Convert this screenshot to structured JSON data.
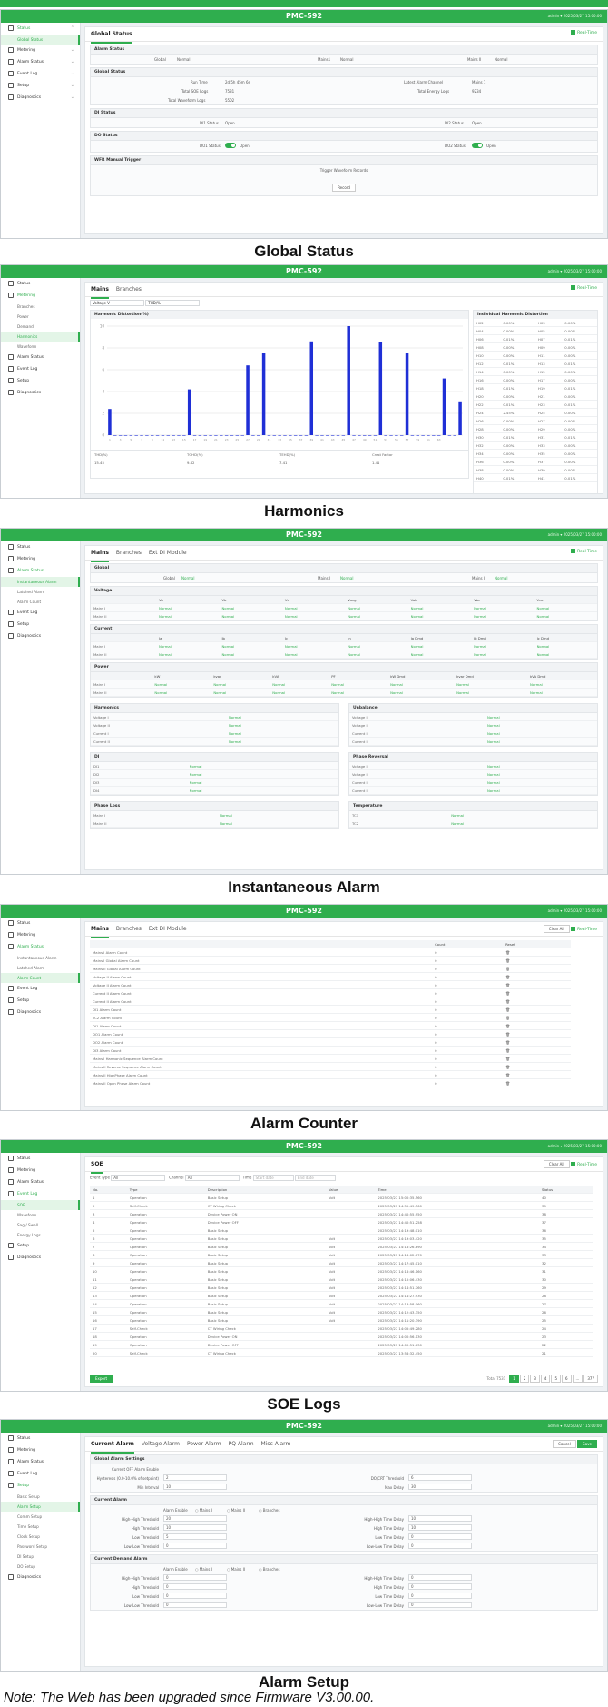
{
  "app_title": "PMC-592",
  "header_right": "admin ▾   2025/03/27  15:00:00",
  "colors": {
    "brand": "#2fae4e",
    "bar": "#1f2fd6"
  },
  "global": {
    "caption": "Global Status",
    "tab": "Global Status",
    "realtime": "Real-Time",
    "sidebar": [
      "Status",
      "Global Status",
      "Metering",
      "Alarm Status",
      "Event Log",
      "Setup",
      "Diagnostics"
    ],
    "alarm_status": {
      "title": "Alarm Status",
      "global_label": "Global",
      "global_val": "Normal",
      "mains_label": "Mains1",
      "mains_val": "Normal",
      "mains2_label": "Mains II",
      "mains2_val": "Normal"
    },
    "global_status": {
      "title": "Global Status",
      "rows": [
        [
          "Run Time",
          "2d 5h 45m 6s",
          "Latest Alarm Channel",
          "Mains 1"
        ],
        [
          "Total SOE Logs",
          "7531",
          "Total Energy Logs",
          "9234"
        ],
        [
          "Total Waveform Logs",
          "5502",
          "",
          ""
        ]
      ]
    },
    "di": {
      "title": "DI Status",
      "a": "DI1 Status",
      "av": "Open",
      "b": "DI2 Status",
      "bv": "Open"
    },
    "do": {
      "title": "DO Status",
      "a": "DO1 Status",
      "av": "Open",
      "b": "DO2 Status",
      "bv": "Open"
    },
    "wfr": {
      "title": "WFR Manual Trigger",
      "label": "Trigger Waveform Records",
      "button": "Record"
    }
  },
  "harm": {
    "caption": "Harmonics",
    "tabs": [
      "Mains",
      "Branches"
    ],
    "sel1": "Voltage V",
    "sel2": "THD/%",
    "panel_title": "Harmonic Distortion(%)",
    "right_title": "Individual Harmonic Distortion",
    "foot": [
      "THD(%)",
      "TOHD(%)",
      "TEHD(%)",
      "Crest Factor"
    ],
    "footv": [
      "15.45",
      "9.82",
      "7.41",
      "1.41"
    ],
    "sidebar": [
      "Status",
      "Metering",
      "Branches",
      "Power",
      "Demand",
      "Harmonics",
      "Waveform",
      "Alarm Status",
      "Event Log",
      "Setup",
      "Diagnostics"
    ],
    "table": [
      [
        "H02",
        "0.00%",
        "H03",
        "0.00%"
      ],
      [
        "H04",
        "0.00%",
        "H05",
        "0.00%"
      ],
      [
        "H06",
        "0.01%",
        "H07",
        "0.01%"
      ],
      [
        "H08",
        "0.00%",
        "H09",
        "0.00%"
      ],
      [
        "H10",
        "0.00%",
        "H11",
        "0.00%"
      ],
      [
        "H12",
        "0.01%",
        "H13",
        "0.01%"
      ],
      [
        "H14",
        "0.00%",
        "H15",
        "0.00%"
      ],
      [
        "H16",
        "0.00%",
        "H17",
        "0.00%"
      ],
      [
        "H18",
        "0.01%",
        "H19",
        "0.01%"
      ],
      [
        "H20",
        "0.00%",
        "H21",
        "0.00%"
      ],
      [
        "H22",
        "0.01%",
        "H23",
        "0.01%"
      ],
      [
        "H24",
        "2.45%",
        "H25",
        "0.00%"
      ],
      [
        "H26",
        "0.00%",
        "H27",
        "0.00%"
      ],
      [
        "H28",
        "0.00%",
        "H29",
        "0.00%"
      ],
      [
        "H30",
        "0.01%",
        "H31",
        "0.01%"
      ],
      [
        "H32",
        "0.00%",
        "H33",
        "0.00%"
      ],
      [
        "H34",
        "0.00%",
        "H35",
        "0.00%"
      ],
      [
        "H36",
        "0.00%",
        "H37",
        "0.00%"
      ],
      [
        "H38",
        "0.00%",
        "H39",
        "0.00%"
      ],
      [
        "H40",
        "0.01%",
        "H41",
        "0.01%"
      ]
    ]
  },
  "chart_data": {
    "type": "bar",
    "title": "Harmonic Distortion(%)",
    "y_ticks": [
      "10",
      "8",
      "6",
      "4",
      "2",
      "0"
    ],
    "ylim": [
      0,
      10
    ],
    "x": [
      1,
      2,
      3,
      4,
      5,
      6,
      7,
      8,
      9,
      10,
      11,
      12,
      13,
      14,
      15,
      16,
      17,
      18,
      19,
      20,
      21,
      22,
      23,
      24,
      25,
      26,
      27,
      28,
      29,
      30,
      31,
      32,
      33,
      34,
      35,
      36,
      37,
      38,
      39,
      40,
      41,
      42,
      43,
      44,
      45,
      46,
      47,
      48,
      49,
      50,
      51,
      52,
      53,
      54,
      55,
      56,
      57,
      58,
      59,
      60,
      61,
      62,
      63
    ],
    "values": [
      2.4,
      0,
      0,
      0,
      0,
      0,
      0,
      0,
      0,
      0,
      0,
      0,
      0,
      0,
      0,
      4.2,
      0,
      0,
      0,
      0,
      0,
      0,
      0,
      0,
      0,
      0,
      6.4,
      0,
      0,
      7.5,
      0,
      0,
      0,
      0,
      0,
      0,
      0,
      0,
      8.6,
      0,
      0,
      0,
      0,
      0,
      0,
      10,
      0,
      0,
      0,
      0,
      0,
      8.5,
      0,
      0,
      0,
      0,
      7.5,
      0,
      0,
      0,
      0,
      0,
      0,
      5.2,
      0,
      0,
      3.1
    ]
  },
  "inst": {
    "caption": "Instantaneous Alarm",
    "tabs": [
      "Mains",
      "Branches",
      "Ext DI Module"
    ],
    "sidebar": [
      "Status",
      "Metering",
      "Alarm Status",
      "Instantaneous Alarm",
      "Latched Alarm",
      "Alarm Count",
      "Event Log",
      "Setup",
      "Diagnostics"
    ],
    "global": [
      "Global",
      "Normal",
      "Mains I",
      "Normal",
      "Mains II",
      "Normal"
    ],
    "sections": [
      "Voltage",
      "Current",
      "Power",
      "Harmonics",
      "Unbalance",
      "DI",
      "Phase Reversal",
      "Phase Loss",
      "Temperature"
    ],
    "n": "Normal"
  },
  "count": {
    "caption": "Alarm Counter",
    "tabs": [
      "Mains",
      "Branches",
      "Ext DI Module"
    ],
    "btns": [
      "Clear All",
      "Real-Time"
    ],
    "cols": [
      "",
      "Count",
      "Reset"
    ],
    "rows": [
      "Mains I Alarm Count",
      "Mains I Global Alarm Count",
      "Mains II Global Alarm Count",
      "Voltage II Alarm Count",
      "Voltage II Alarm Count",
      "Current II Alarm Count",
      "Current II Alarm Count",
      "DI1 Alarm Count",
      "TC2 Alarm Count",
      "DI1 Alarm Count",
      "DO1 Alarm Count",
      "DO2 Alarm Count",
      "DI3 Alarm Count",
      "Mains I Harmonic Sequence Alarm Count",
      "Mains II Reverse Sequence Alarm Count",
      "Mains II HighPhase Alarm Count",
      "Mains II Open Phase Alarm Count"
    ],
    "cnt": "0",
    "sidebar": [
      "Status",
      "Metering",
      "Alarm Status",
      "Instantaneous Alarm",
      "Latched Alarm",
      "Alarm Count",
      "Event Log",
      "Setup",
      "Diagnostics"
    ]
  },
  "soe": {
    "caption": "SOE Logs",
    "title": "SOE",
    "filters": [
      "Event Type",
      "All",
      "Channel",
      "All",
      "Time",
      "Start date",
      "End date"
    ],
    "btns": [
      "Clear All",
      "Real-Time",
      "Export"
    ],
    "cols": [
      "No.",
      "Type",
      "Description",
      "Value",
      "Time",
      "Status"
    ],
    "rows": [
      [
        "1",
        "Operation",
        "Basic Setup",
        "Volt",
        "2025/03/27 15:00:35.560",
        "40"
      ],
      [
        "2",
        "Self-Check",
        "CT Wiring Check",
        "",
        "2025/03/27 14:59:49.560",
        "39"
      ],
      [
        "3",
        "Operation",
        "Device Power ON",
        "",
        "2025/03/27 14:40:55.950",
        "38"
      ],
      [
        "4",
        "Operation",
        "Device Power OFF",
        "",
        "2025/03/27 14:40:51.258",
        "37"
      ],
      [
        "5",
        "Operation",
        "Basic Setup",
        "",
        "2025/03/27 14:19:48.010",
        "36"
      ],
      [
        "6",
        "Operation",
        "Basic Setup",
        "Volt",
        "2025/03/27 14:19:03.420",
        "35"
      ],
      [
        "7",
        "Operation",
        "Basic Setup",
        "Volt",
        "2025/03/27 14:18:26.890",
        "34"
      ],
      [
        "8",
        "Operation",
        "Basic Setup",
        "Volt",
        "2025/03/27 14:18:02.070",
        "33"
      ],
      [
        "9",
        "Operation",
        "Basic Setup",
        "Volt",
        "2025/03/27 14:17:45.010",
        "32"
      ],
      [
        "10",
        "Operation",
        "Basic Setup",
        "Volt",
        "2025/03/27 14:16:46.160",
        "31"
      ],
      [
        "11",
        "Operation",
        "Basic Setup",
        "Volt",
        "2025/03/27 14:15:06.430",
        "30"
      ],
      [
        "12",
        "Operation",
        "Basic Setup",
        "Volt",
        "2025/03/27 14:14:51.760",
        "29"
      ],
      [
        "13",
        "Operation",
        "Basic Setup",
        "Volt",
        "2025/03/27 14:14:27.930",
        "28"
      ],
      [
        "14",
        "Operation",
        "Basic Setup",
        "Volt",
        "2025/03/27 14:13:58.060",
        "27"
      ],
      [
        "15",
        "Operation",
        "Basic Setup",
        "Volt",
        "2025/03/27 14:12:43.350",
        "26"
      ],
      [
        "16",
        "Operation",
        "Basic Setup",
        "Volt",
        "2025/03/27 14:11:20.390",
        "25"
      ],
      [
        "17",
        "Self-Check",
        "CT Wiring Check",
        "",
        "2025/03/27 14:05:49.280",
        "24"
      ],
      [
        "18",
        "Operation",
        "Device Power ON",
        "",
        "2025/03/27 14:00:56.130",
        "23"
      ],
      [
        "19",
        "Operation",
        "Device Power OFF",
        "",
        "2025/03/27 14:00:51.630",
        "22"
      ],
      [
        "20",
        "Self-Check",
        "CT Wiring Check",
        "",
        "2025/03/27 13:58:32.450",
        "21"
      ]
    ],
    "total": "Total 7531",
    "pages": [
      "1",
      "2",
      "3",
      "4",
      "5",
      "6",
      "...",
      "377"
    ],
    "sidebar": [
      "Status",
      "Metering",
      "Alarm Status",
      "Event Log",
      "SOE",
      "Waveform",
      "Sag / Swell",
      "Energy Logs",
      "Setup",
      "Diagnostics"
    ]
  },
  "setup": {
    "caption": "Alarm Setup",
    "tabs": [
      "Current Alarm",
      "Voltage Alarm",
      "Power Alarm",
      "PQ Alarm",
      "Misc Alarm"
    ],
    "btns": [
      "Cancel",
      "Save"
    ],
    "g_title": "Global Alarm Settings",
    "g_rows": [
      [
        "Current OFF Alarm Enable",
        "",
        "",
        ""
      ],
      [
        "Hysteresis (0.0-10.0% of setpoint)",
        "2",
        "DO/CRT Threshold",
        "6"
      ],
      [
        "Min Interval",
        "10",
        "Max Delay",
        "30"
      ]
    ],
    "c_title": "Current Alarm",
    "c_rows": [
      [
        "High-High Threshold",
        "20",
        "High-High Time Delay",
        "10"
      ],
      [
        "High Threshold",
        "10",
        "High Time Delay",
        "10"
      ],
      [
        "Low Threshold",
        "5",
        "Low Time Delay",
        "0"
      ],
      [
        "Low-Low Threshold",
        "0",
        "Low-Low Time Delay",
        "0"
      ]
    ],
    "d_title": "Current Demand Alarm",
    "d_rows": [
      [
        "High-High Threshold",
        "0",
        "High-High Time Delay",
        "0"
      ],
      [
        "High Threshold",
        "0",
        "High Time Delay",
        "0"
      ],
      [
        "Low Threshold",
        "0",
        "Low Time Delay",
        "0"
      ],
      [
        "Low-Low Threshold",
        "0",
        "Low-Low Time Delay",
        "0"
      ]
    ],
    "enable": [
      "Alarm Enable",
      "Mains I",
      "Mains II",
      "Branches"
    ],
    "sidebar": [
      "Status",
      "Metering",
      "Alarm Status",
      "Event Log",
      "Setup",
      "Basic Setup",
      "Alarm Setup",
      "Comm Setup",
      "Time Setup",
      "Clock Setup",
      "Password Setup",
      "DI Setup",
      "DO Setup",
      "Diagnostics"
    ]
  },
  "note": "Note: The Web has been upgraded since Firmware V3.00.00."
}
